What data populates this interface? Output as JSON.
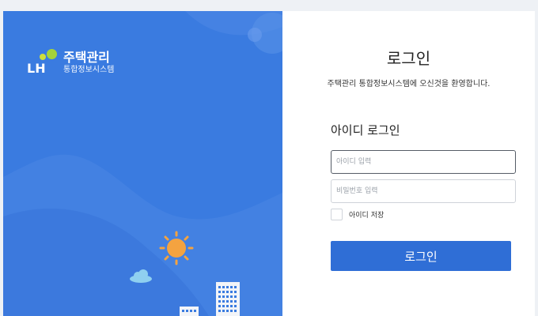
{
  "brand": {
    "logo_letters": "LH",
    "main": "주택관리",
    "sub": "통합정보시스템"
  },
  "login": {
    "title": "로그인",
    "welcome": "주택관리 통합정보시스템에 오신것을 환영합니다.",
    "section_title": "아이디 로그인",
    "id_placeholder": "아이디 입력",
    "pw_placeholder": "비밀번호 입력",
    "remember_label": "아이디 저장",
    "button_label": "로그인"
  },
  "colors": {
    "panel_blue": "#3a7be0",
    "button_blue": "#2f6ed6",
    "logo_green": "#a5d23b",
    "sun": "#f4a340"
  }
}
